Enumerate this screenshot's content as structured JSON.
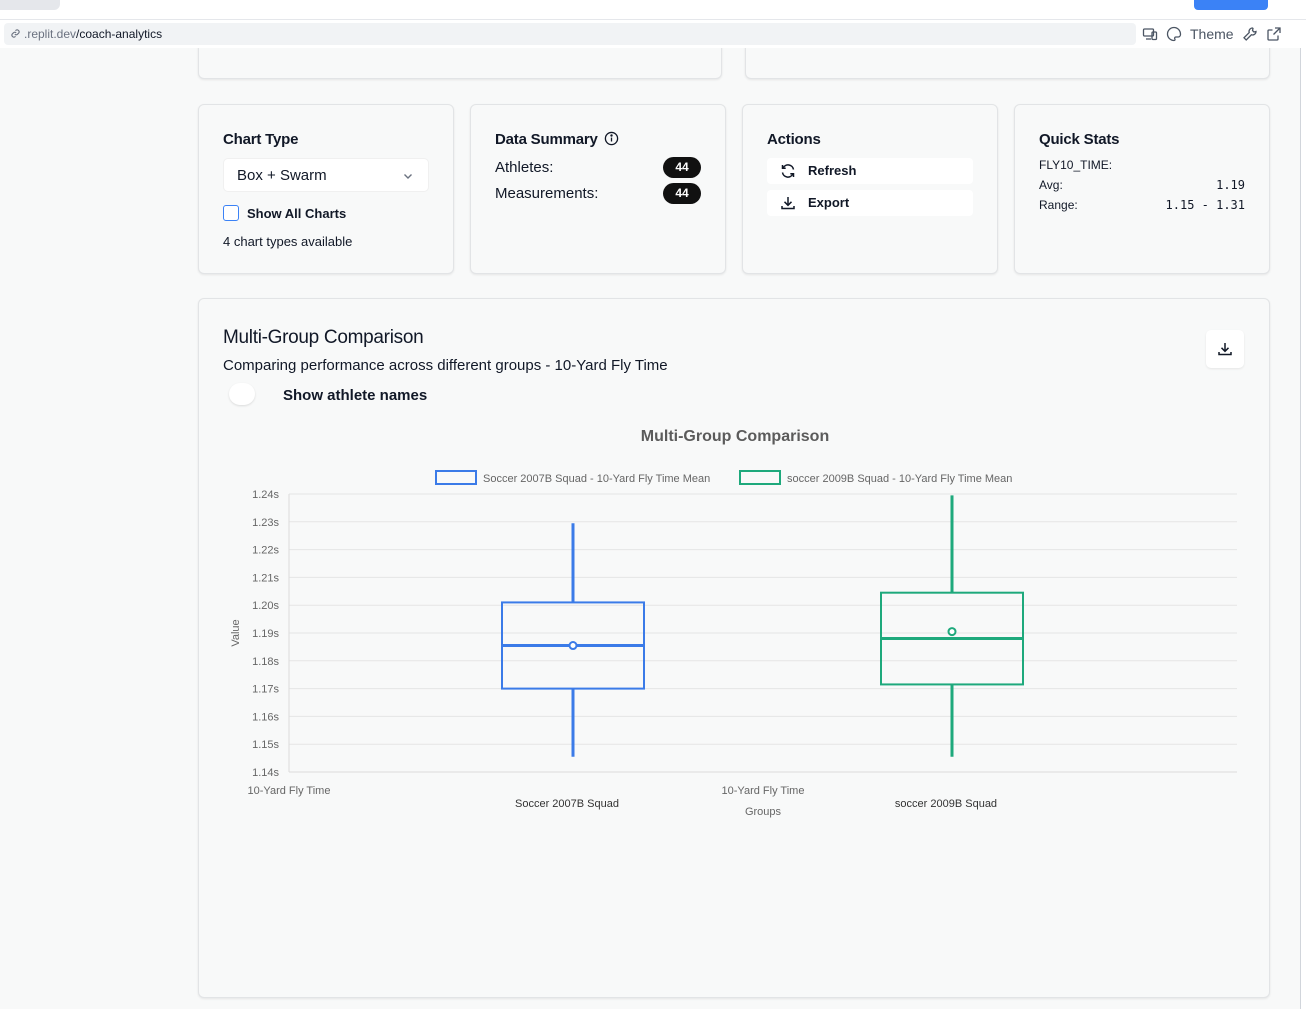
{
  "url": {
    "host": ".replit.dev",
    "path": "/coach-analytics"
  },
  "toolbar": {
    "theme_label": "Theme"
  },
  "chart_type_card": {
    "title": "Chart Type",
    "selected": "Box + Swarm",
    "show_all_label": "Show All Charts",
    "available_text": "4 chart types available"
  },
  "data_summary": {
    "title": "Data Summary",
    "athletes_label": "Athletes:",
    "athletes_count": "44",
    "measurements_label": "Measurements:",
    "measurements_count": "44"
  },
  "actions": {
    "title": "Actions",
    "refresh_label": "Refresh",
    "export_label": "Export"
  },
  "quick_stats": {
    "title": "Quick Stats",
    "metric": "FLY10_TIME:",
    "avg_label": "Avg:",
    "avg_value": "1.19",
    "range_label": "Range:",
    "range_value": "1.15 - 1.31"
  },
  "comparison": {
    "title": "Multi-Group Comparison",
    "subtitle": "Comparing performance across different groups - 10-Yard Fly Time",
    "toggle_label": "Show athlete names"
  },
  "chart_data": {
    "type": "box",
    "title": "Multi-Group Comparison",
    "ylabel": "Value",
    "xlabel": "Groups",
    "ylim": [
      1.14,
      1.24
    ],
    "yticks": [
      "1.24s",
      "1.23s",
      "1.22s",
      "1.21s",
      "1.20s",
      "1.19s",
      "1.18s",
      "1.17s",
      "1.16s",
      "1.15s",
      "1.14s"
    ],
    "xtick_labels": [
      "10-Yard Fly Time",
      "10-Yard Fly Time"
    ],
    "categories": [
      "Soccer 2007B Squad",
      "soccer 2009B Squad"
    ],
    "legend_placement": "top",
    "grid": true,
    "series": [
      {
        "name": "Soccer 2007B Squad - 10-Yard Fly Time Mean",
        "color": "#3b7be8",
        "min": 1.1455,
        "q1": 1.17,
        "median": 1.1855,
        "mean": 1.1855,
        "q3": 1.201,
        "max": 1.2295
      },
      {
        "name": "soccer 2009B Squad - 10-Yard Fly Time Mean",
        "color": "#1ea97c",
        "min": 1.1455,
        "q1": 1.1715,
        "median": 1.188,
        "mean": 1.1905,
        "q3": 1.2045,
        "max": 1.2395
      }
    ]
  }
}
